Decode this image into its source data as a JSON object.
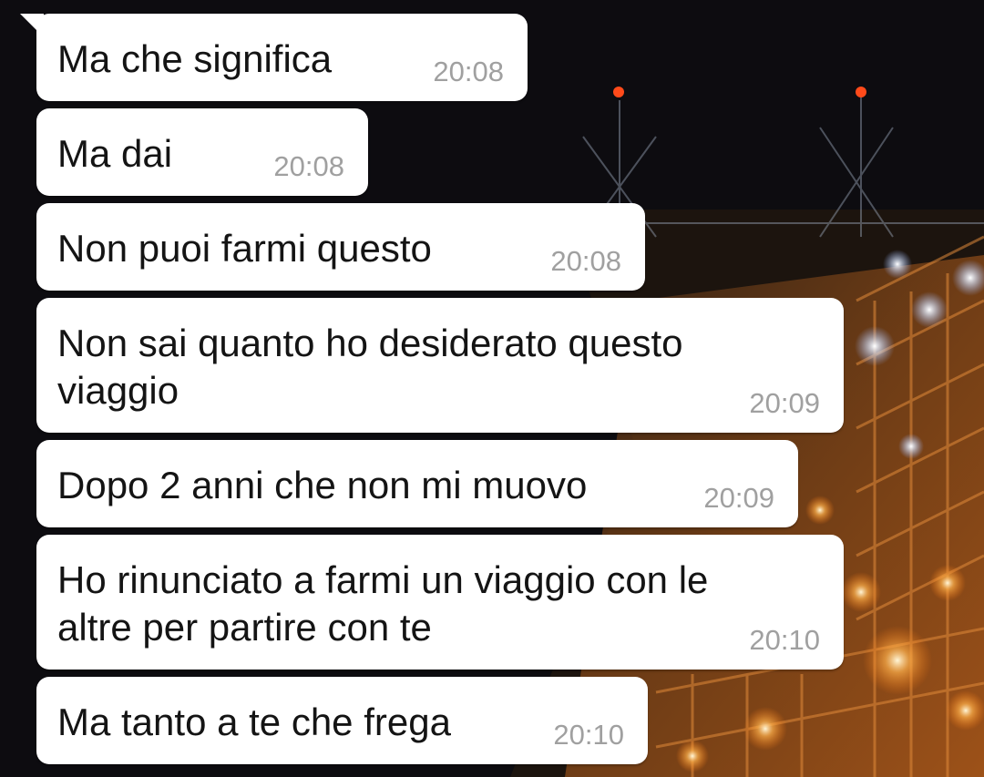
{
  "conversation": {
    "messages": [
      {
        "text": "Ma che significa",
        "time": "20:08"
      },
      {
        "text": "Ma dai",
        "time": "20:08"
      },
      {
        "text": "Non puoi farmi questo",
        "time": "20:08"
      },
      {
        "text": "Non sai quanto ho desiderato questo\nviaggio",
        "time": "20:09"
      },
      {
        "text": "Dopo 2 anni che non mi muovo",
        "time": "20:09"
      },
      {
        "text": "Ho rinunciato a farmi un viaggio con le\naltre per partire con te",
        "time": "20:10"
      },
      {
        "text": "Ma tanto a te che frega",
        "time": "20:10"
      }
    ]
  },
  "colors": {
    "bubble_background": "#ffffff",
    "message_text": "#141414",
    "timestamp_text": "#a0a0a0",
    "wallpaper_sky": "#0d0c10",
    "wallpaper_lights": "#ff8a1e"
  }
}
